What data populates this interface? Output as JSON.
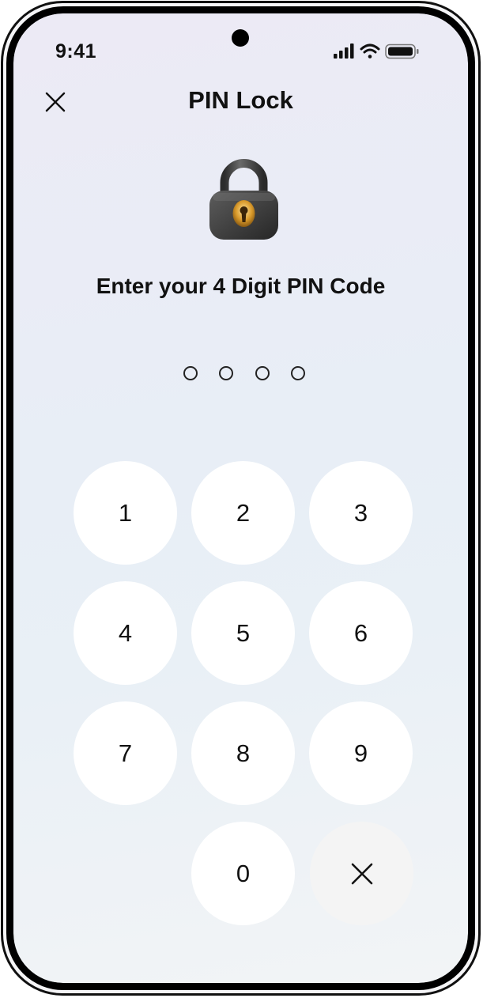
{
  "status_bar": {
    "time": "9:41",
    "icons": [
      "signal-icon",
      "wifi-icon",
      "battery-icon"
    ]
  },
  "header": {
    "close_icon": "close-icon",
    "title": "PIN Lock"
  },
  "lock_icon": "padlock-icon",
  "prompt": "Enter your 4 Digit PIN Code",
  "pin": {
    "length": 4,
    "entered": 0
  },
  "keypad": {
    "keys": [
      "1",
      "2",
      "3",
      "4",
      "5",
      "6",
      "7",
      "8",
      "9",
      "0"
    ],
    "delete_icon": "delete-icon"
  },
  "colors": {
    "key_background": "#ffffff",
    "delete_key_background": "#f4f4f4",
    "text": "#111111"
  }
}
